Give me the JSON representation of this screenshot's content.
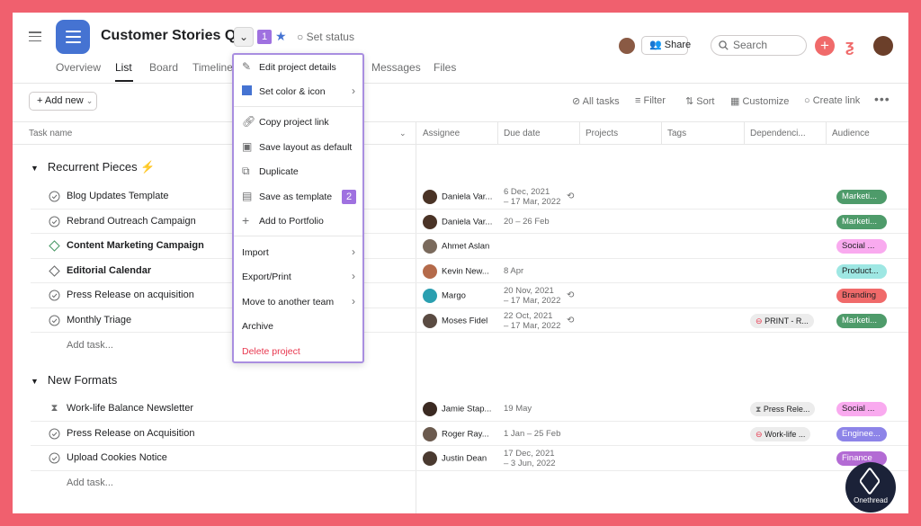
{
  "colors": {
    "frame": "#f0606e",
    "project_icon": "#4573d2",
    "menu_border": "#a98ee0",
    "step_badge": "#9f71e0",
    "delete_red": "#e8384f",
    "plus_red": "#f06a6a"
  },
  "header": {
    "project_title": "Customer Stories Q4",
    "step1": "1",
    "set_status": "Set status",
    "share": "Share",
    "search_placeholder": "Search",
    "plus": "+"
  },
  "tabs": [
    "Overview",
    "List",
    "Board",
    "Timeline",
    "Messages",
    "Files"
  ],
  "toolbar": {
    "add_task": "+ Add new",
    "all_tasks": "All tasks",
    "filter": "Filter",
    "sort": "Sort",
    "customize": "Customize",
    "create_link": "Create link"
  },
  "columns": [
    "Task name",
    "Assignee",
    "Due date",
    "Projects",
    "Tags",
    "Dependenci...",
    "Audience"
  ],
  "sections": [
    {
      "title": "Recurrent Pieces",
      "add_task": "Add task...",
      "rows": [
        {
          "name": "Blog Updates Template",
          "assignee": "Daniela Var...",
          "due1": "6 Dec, 2021",
          "due2": "– 17 Mar, 2022",
          "audience": "Marketi...",
          "dep": ""
        },
        {
          "name": "Rebrand Outreach Campaign",
          "assignee": "Daniela Var...",
          "due1": "20 – 26 Feb",
          "due2": "",
          "audience": "Marketi...",
          "dep": ""
        },
        {
          "name": "Content Marketing Campaign",
          "assignee": "Ahmet Aslan",
          "due1": "",
          "due2": "",
          "audience": "Social ...",
          "dep": ""
        },
        {
          "name": "Editorial Calendar",
          "assignee": "Kevin New...",
          "due1": "8 Apr",
          "due2": "",
          "audience": "Product...",
          "dep": ""
        },
        {
          "name": "Press Release on acquisition",
          "assignee": "Margo",
          "due1": "20 Nov, 2021",
          "due2": "– 17 Mar, 2022",
          "audience": "Branding",
          "dep": ""
        },
        {
          "name": "Monthly Triage",
          "assignee": "Moses Fidel",
          "due1": "22 Oct, 2021",
          "due2": "– 17 Mar, 2022",
          "audience": "Marketi...",
          "dep": "PRINT - R..."
        }
      ]
    },
    {
      "title": "New Formats",
      "add_task": "Add task...",
      "rows": [
        {
          "name": "Work-life Balance Newsletter",
          "assignee": "Jamie Stap...",
          "due1": "19 May",
          "due2": "",
          "audience": "Social ...",
          "dep": "Press Rele..."
        },
        {
          "name": "Press Release on Acquisition",
          "assignee": "Roger Ray...",
          "due1": "1 Jan – 25 Feb",
          "due2": "",
          "audience": "Enginee...",
          "dep": "Work-life ..."
        },
        {
          "name": "Upload Cookies Notice",
          "assignee": "Justin Dean",
          "due1": "17 Dec, 2021",
          "due2": "– 3 Jun, 2022",
          "audience": "Finance",
          "dep": ""
        }
      ]
    }
  ],
  "menu": {
    "edit_details": "Edit project details",
    "set_color": "Set color & icon",
    "copy_link": "Copy project link",
    "save_layout": "Save layout as default",
    "duplicate": "Duplicate",
    "save_template": "Save as template",
    "step2": "2",
    "add_portfolio": "Add to Portfolio",
    "import": "Import",
    "export": "Export/Print",
    "move_team": "Move to another team",
    "archive": "Archive",
    "delete": "Delete project"
  },
  "watermark": "Onethread"
}
